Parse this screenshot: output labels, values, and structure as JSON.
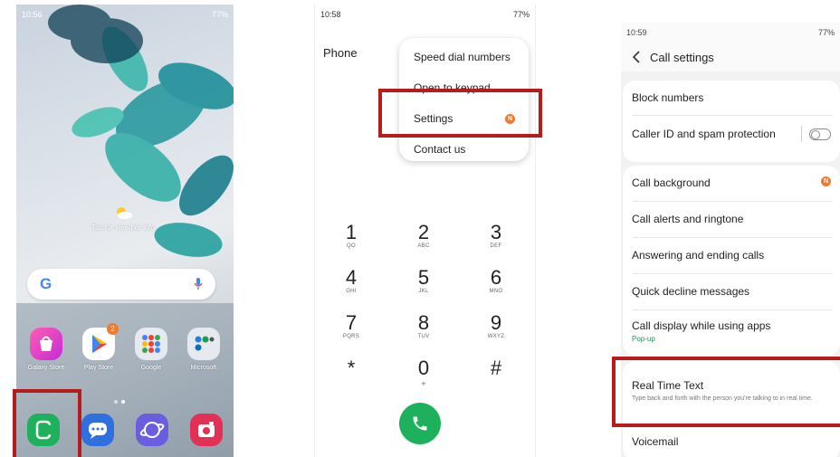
{
  "home": {
    "status_time": "10:56",
    "status_right": "77%",
    "weather_text": "Tap for weather info",
    "apps": [
      {
        "label": "Galaxy Store",
        "icon": "galaxy-store-icon",
        "color": "#e0338f"
      },
      {
        "label": "Play Store",
        "icon": "play-store-icon",
        "color": "#ffffff",
        "badge": "2"
      },
      {
        "label": "Google",
        "icon": "google-folder-icon",
        "color": "#dfe3e8"
      },
      {
        "label": "Microsoft",
        "icon": "microsoft-folder-icon",
        "color": "#dfe3e8"
      }
    ],
    "dock": [
      {
        "icon": "phone-app-icon",
        "color": "#1db15c"
      },
      {
        "icon": "messages-app-icon",
        "color": "#2f6fde"
      },
      {
        "icon": "internet-app-icon",
        "color": "#6a5de0"
      },
      {
        "icon": "camera-app-icon",
        "color": "#e33055"
      }
    ]
  },
  "dialer": {
    "status_time": "10:58",
    "status_right": "77%",
    "title": "Phone",
    "menu": [
      "Speed dial numbers",
      "Open to keypad",
      "Settings",
      "Contact us"
    ],
    "settings_badge": "N",
    "keys": [
      {
        "digit": "1",
        "letters": "QO"
      },
      {
        "digit": "2",
        "letters": "ABC"
      },
      {
        "digit": "3",
        "letters": "DEF"
      },
      {
        "digit": "4",
        "letters": "GHI"
      },
      {
        "digit": "5",
        "letters": "JKL"
      },
      {
        "digit": "6",
        "letters": "MNO"
      },
      {
        "digit": "7",
        "letters": "PQRS"
      },
      {
        "digit": "8",
        "letters": "TUV"
      },
      {
        "digit": "9",
        "letters": "WXYZ"
      },
      {
        "digit": "*",
        "letters": ""
      },
      {
        "digit": "0",
        "letters": "+"
      },
      {
        "digit": "#",
        "letters": ""
      }
    ]
  },
  "settings": {
    "status_time": "10:59",
    "status_right": "77%",
    "title": "Call settings",
    "block_numbers": "Block numbers",
    "caller_id": "Caller ID and spam protection",
    "caller_id_on": false,
    "call_background": "Call background",
    "call_background_badge": "N",
    "call_alerts": "Call alerts and ringtone",
    "answering": "Answering and ending calls",
    "quick_decline": "Quick decline messages",
    "call_display": "Call display while using apps",
    "call_display_sub": "Pop-up",
    "rtt": "Real Time Text",
    "rtt_sub": "Type back and forth with the person you're talking to in real time.",
    "voicemail": "Voicemail"
  },
  "colors": {
    "highlight": "#b71c1c",
    "accent_orange": "#f07a2e",
    "call_green": "#1db15c"
  }
}
